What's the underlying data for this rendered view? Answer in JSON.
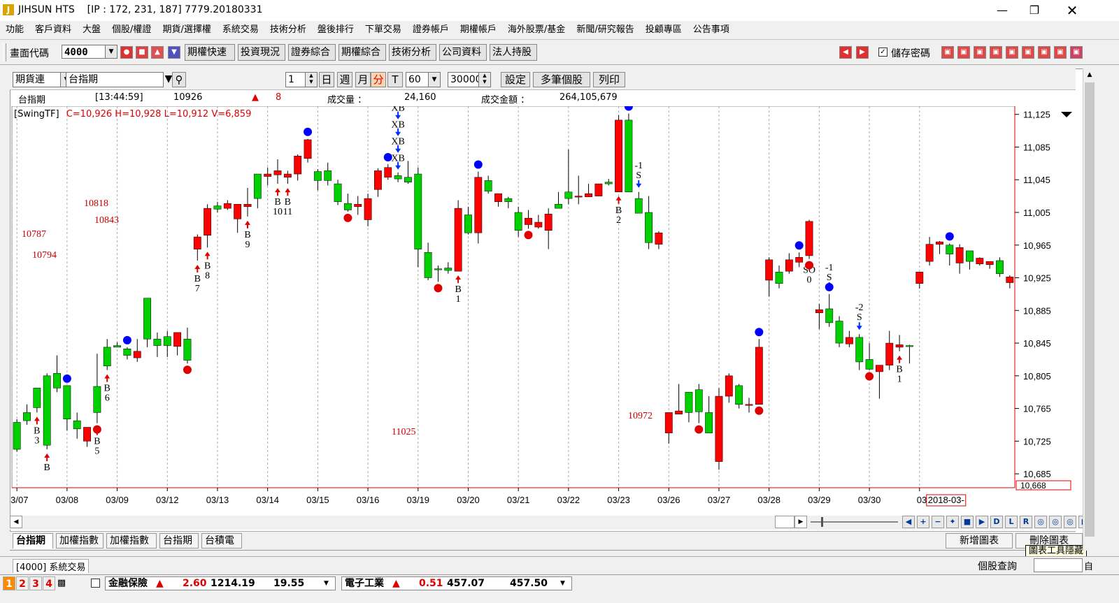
{
  "window": {
    "title": "JIHSUN HTS",
    "ip_info": "[IP : 172, 231, 187] 7779.20180331",
    "icon_letter": "J"
  },
  "menu": [
    "功能",
    "客戶資料",
    "大盤",
    "個股/權證",
    "期貨/選擇權",
    "系統交易",
    "技術分析",
    "盤後排行",
    "下單交易",
    "證券帳戶",
    "期權帳戶",
    "海外股票/基金",
    "新聞/研究報告",
    "投顧專區",
    "公告事項"
  ],
  "toolbar": {
    "screen_code_label": "畫面代碼",
    "screen_code_value": "4000",
    "buttons": [
      "期權快速",
      "投資現況",
      "證券綜合",
      "期權綜合",
      "技術分析",
      "公司資料",
      "法人持股"
    ],
    "save_password_label": "儲存密碼"
  },
  "chart_toolbar": {
    "type_select": "期貨連",
    "symbol_select": "台指期",
    "count_value": "1",
    "periods": [
      "日",
      "週",
      "月",
      "分",
      "T"
    ],
    "minute_value": "60",
    "bars_value": "30000",
    "settings_button": "設定",
    "multi_button": "多筆個股",
    "print_button": "列印"
  },
  "quote": {
    "name": "台指期",
    "time": "[13:44:59]",
    "price": "10926",
    "change": "8",
    "volume_label": "成交量 ：",
    "volume": "24,160",
    "amount_label": "成交金額 ：",
    "amount": "264,105,679"
  },
  "indicator": {
    "name": "[SwingTF]",
    "values": "C=10,926 H=10,928 L=10,912 V=6,859"
  },
  "colors": {
    "up": "#ff0000",
    "down": "#00d000",
    "blue_dot": "#0000ff",
    "red_text": "#cc0000"
  },
  "chart_data": {
    "type": "candlestick",
    "y_ticks": [
      "11,125",
      "11,085",
      "11,045",
      "11,005",
      "10,965",
      "10,925",
      "10,885",
      "10,845",
      "10,805",
      "10,765",
      "10,725",
      "10,685"
    ],
    "ylim": [
      10668,
      11135
    ],
    "current_label": "10,668",
    "x_labels": [
      "03/07",
      "03/08",
      "03/09",
      "03/12",
      "03/13",
      "03/14",
      "03/15",
      "03/16",
      "03/19",
      "03/20",
      "03/21",
      "03/22",
      "03/23",
      "03/26",
      "03/27",
      "03/28",
      "03/29",
      "03/30",
      "2018-03-"
    ],
    "x_label_prefix": "03",
    "bars_per_day": 5,
    "candles": [
      [
        10748,
        10715,
        10752,
        10712
      ],
      [
        10760,
        10750,
        10770,
        10745
      ],
      [
        10790,
        10766,
        10790,
        10760
      ],
      [
        10805,
        10720,
        10808,
        10715
      ],
      [
        10808,
        10790,
        10830,
        10785
      ],
      [
        10793,
        10752,
        10793,
        10738
      ],
      [
        10750,
        10740,
        10760,
        10728
      ],
      [
        10725,
        10742,
        10742,
        10718
      ],
      [
        10792,
        10760,
        10832,
        10747
      ],
      [
        10840,
        10817,
        10850,
        10812
      ],
      [
        10842,
        10840,
        10846,
        10840
      ],
      [
        10838,
        10830,
        10840,
        10825
      ],
      [
        10827,
        10835,
        10850,
        10822
      ],
      [
        10900,
        10850,
        10900,
        10840
      ],
      [
        10850,
        10842,
        10858,
        10828
      ],
      [
        10853,
        10842,
        10860,
        10828
      ],
      [
        10841,
        10858,
        10858,
        10830
      ],
      [
        10850,
        10824,
        10864,
        10820
      ],
      [
        10960,
        10975,
        10978,
        10946
      ],
      [
        10977,
        11010,
        11015,
        10962
      ],
      [
        11013,
        11009,
        11018,
        11005
      ],
      [
        11010,
        11016,
        11020,
        11008
      ],
      [
        10997,
        11015,
        11015,
        10980
      ],
      [
        11012,
        11015,
        11035,
        11000
      ],
      [
        11052,
        11022,
        11052,
        11010
      ],
      [
        11049,
        11052,
        11060,
        11038
      ],
      [
        11051,
        11056,
        11070,
        11040
      ],
      [
        11048,
        11052,
        11056,
        11040
      ],
      [
        11052,
        11074,
        11076,
        11044
      ],
      [
        11071,
        11094,
        11095,
        11066
      ],
      [
        11055,
        11044,
        11058,
        11032
      ],
      [
        11056,
        11044,
        11066,
        11038
      ],
      [
        11040,
        11018,
        11045,
        11014
      ],
      [
        11016,
        11008,
        11028,
        11006
      ],
      [
        11012,
        11015,
        11025,
        11002
      ],
      [
        10996,
        11022,
        11028,
        10988
      ],
      [
        11033,
        11056,
        11059,
        11024
      ],
      [
        11048,
        11060,
        11064,
        11045
      ],
      [
        11050,
        11046,
        11054,
        11042
      ],
      [
        11048,
        11042,
        11068,
        11040
      ],
      [
        11052,
        10960,
        11060,
        10938
      ],
      [
        10956,
        10925,
        10968,
        10922
      ],
      [
        10936,
        10935,
        10940,
        10920
      ],
      [
        10937,
        10934,
        10944,
        10930
      ],
      [
        10933,
        11010,
        11020,
        10933
      ],
      [
        11002,
        10980,
        11012,
        10978
      ],
      [
        10980,
        11048,
        11055,
        10967
      ],
      [
        11044,
        11031,
        11050,
        11028
      ],
      [
        11018,
        11028,
        11028,
        11012
      ],
      [
        11022,
        11018,
        11024,
        11010
      ],
      [
        11005,
        10983,
        11012,
        10975
      ],
      [
        10990,
        10998,
        11008,
        10985
      ],
      [
        10987,
        10993,
        11002,
        10985
      ],
      [
        10983,
        11003,
        11010,
        10960
      ],
      [
        11015,
        11010,
        11030,
        11012
      ],
      [
        11030,
        11022,
        11082,
        11015
      ],
      [
        11024,
        11025,
        11050,
        11015
      ],
      [
        11024,
        11028,
        11040,
        11024
      ],
      [
        11025,
        11040,
        11040,
        11030
      ],
      [
        11042,
        11040,
        11046,
        11038
      ],
      [
        11030,
        11118,
        11124,
        11030
      ],
      [
        11118,
        11030,
        11126,
        11030
      ],
      [
        11022,
        11004,
        11030,
        11004
      ],
      [
        11005,
        10968,
        11025,
        10960
      ],
      [
        10966,
        10980,
        10982,
        10960
      ],
      [
        10735,
        10760,
        10760,
        10722
      ],
      [
        10758,
        10762,
        10795,
        10760
      ],
      [
        10785,
        10760,
        10785,
        10748
      ],
      [
        10788,
        10761,
        10795,
        10747
      ],
      [
        10760,
        10735,
        10780,
        10735
      ],
      [
        10700,
        10780,
        10790,
        10690
      ],
      [
        10780,
        10805,
        10808,
        10772
      ],
      [
        10793,
        10770,
        10795,
        10765
      ],
      [
        10770,
        10770,
        10778,
        10760
      ],
      [
        10770,
        10840,
        10850,
        10770
      ],
      [
        10922,
        10947,
        10950,
        10902
      ],
      [
        10932,
        10918,
        10940,
        10912
      ],
      [
        10933,
        10947,
        10955,
        10930
      ],
      [
        10944,
        10950,
        10956,
        10938
      ],
      [
        10952,
        10994,
        10996,
        10948
      ],
      [
        10882,
        10886,
        10893,
        10862
      ],
      [
        10887,
        10870,
        10905,
        10865
      ],
      [
        10872,
        10845,
        10878,
        10840
      ],
      [
        10844,
        10852,
        10860,
        10840
      ],
      [
        10852,
        10822,
        10856,
        10812
      ],
      [
        10825,
        10813,
        10845,
        10812
      ],
      [
        10810,
        10818,
        10818,
        10777
      ],
      [
        10818,
        10845,
        10860,
        10812
      ],
      [
        10840,
        10843,
        10855,
        10835
      ],
      [
        10842,
        10841,
        10843,
        10820
      ],
      [
        10918,
        10932,
        10932,
        10912
      ],
      [
        10945,
        10966,
        10975,
        10940
      ],
      [
        10966,
        10969,
        10970,
        10954
      ],
      [
        10965,
        10954,
        10967,
        10940
      ],
      [
        10943,
        10962,
        10966,
        10930
      ],
      [
        10958,
        10945,
        10958,
        10935
      ],
      [
        10942,
        10949,
        10950,
        10940
      ],
      [
        10941,
        10945,
        10945,
        10936
      ],
      [
        10946,
        10930,
        10950,
        10926
      ],
      [
        10919,
        10926,
        10928,
        10912
      ]
    ],
    "signals": [
      {
        "i": 3,
        "kind": "buy",
        "label": [
          "B"
        ]
      },
      {
        "i": 2,
        "kind": "buy",
        "label": [
          "B",
          "3"
        ]
      },
      {
        "i": 8,
        "kind": "buy",
        "label": [
          "B",
          "5"
        ]
      },
      {
        "i": 9,
        "kind": "buy",
        "label": [
          "B",
          "6"
        ]
      },
      {
        "i": 18,
        "kind": "buy",
        "label": [
          "B",
          "7"
        ]
      },
      {
        "i": 19,
        "kind": "buy",
        "label": [
          "B",
          "8"
        ]
      },
      {
        "i": 23,
        "kind": "buy",
        "label": [
          "B",
          "9"
        ]
      },
      {
        "i": 26,
        "kind": "buy",
        "label": [
          "B",
          "10"
        ]
      },
      {
        "i": 27,
        "kind": "buy",
        "label": [
          "B",
          "11"
        ]
      },
      {
        "i": 44,
        "kind": "buy",
        "label": [
          "B",
          "1"
        ]
      },
      {
        "i": 60,
        "kind": "buy",
        "label": [
          "B",
          "2"
        ]
      },
      {
        "i": 88,
        "kind": "buy",
        "label": [
          "B",
          "1"
        ]
      },
      {
        "i": 62,
        "kind": "sell",
        "label": [
          "-1",
          "S"
        ]
      },
      {
        "i": 81,
        "kind": "sell",
        "label": [
          "-1",
          "S"
        ]
      },
      {
        "i": 84,
        "kind": "sell",
        "label": [
          "-2",
          "S"
        ]
      }
    ],
    "stack_label": [
      "XB",
      "XB",
      "XB",
      "XB"
    ],
    "stack_at": 38,
    "so_label": {
      "i": 79,
      "text": [
        "SO",
        "0"
      ]
    },
    "blue_dots": [
      5,
      11,
      29,
      37,
      46,
      61,
      74,
      78,
      81,
      93
    ],
    "red_dots": [
      17,
      8,
      33,
      42,
      51,
      68,
      74,
      79,
      85
    ],
    "floating_numbers": [
      {
        "text": "10818",
        "x": 120,
        "y": 290
      },
      {
        "text": "10843",
        "x": 135,
        "y": 314
      },
      {
        "text": "10787",
        "x": 31,
        "y": 334
      },
      {
        "text": "10794",
        "x": 46,
        "y": 364
      },
      {
        "text": "11025",
        "x": 560,
        "y": 617
      },
      {
        "text": "10972",
        "x": 898,
        "y": 594
      }
    ]
  },
  "bottom_tabs": [
    "台指期",
    "加權指數",
    "加權指數",
    "台指期",
    "台積電"
  ],
  "chart_buttons": {
    "add": "新增圖表",
    "delete": "刪除圖表",
    "tooltip": "圖表工具隱藏"
  },
  "nav_letters": [
    "D",
    "L",
    "R"
  ],
  "status": {
    "code": "[4000] 系統交易",
    "stock_query": "個股查詢",
    "self": "自"
  },
  "ticker_nums": [
    "1",
    "2",
    "3",
    "4"
  ],
  "ticker": [
    {
      "name": "金融保險",
      "change": "2.60",
      "value": "1214.19",
      "volume": "19.55"
    },
    {
      "name": "電子工業",
      "change": "0.51",
      "value": "457.07",
      "volume": "457.50"
    }
  ]
}
